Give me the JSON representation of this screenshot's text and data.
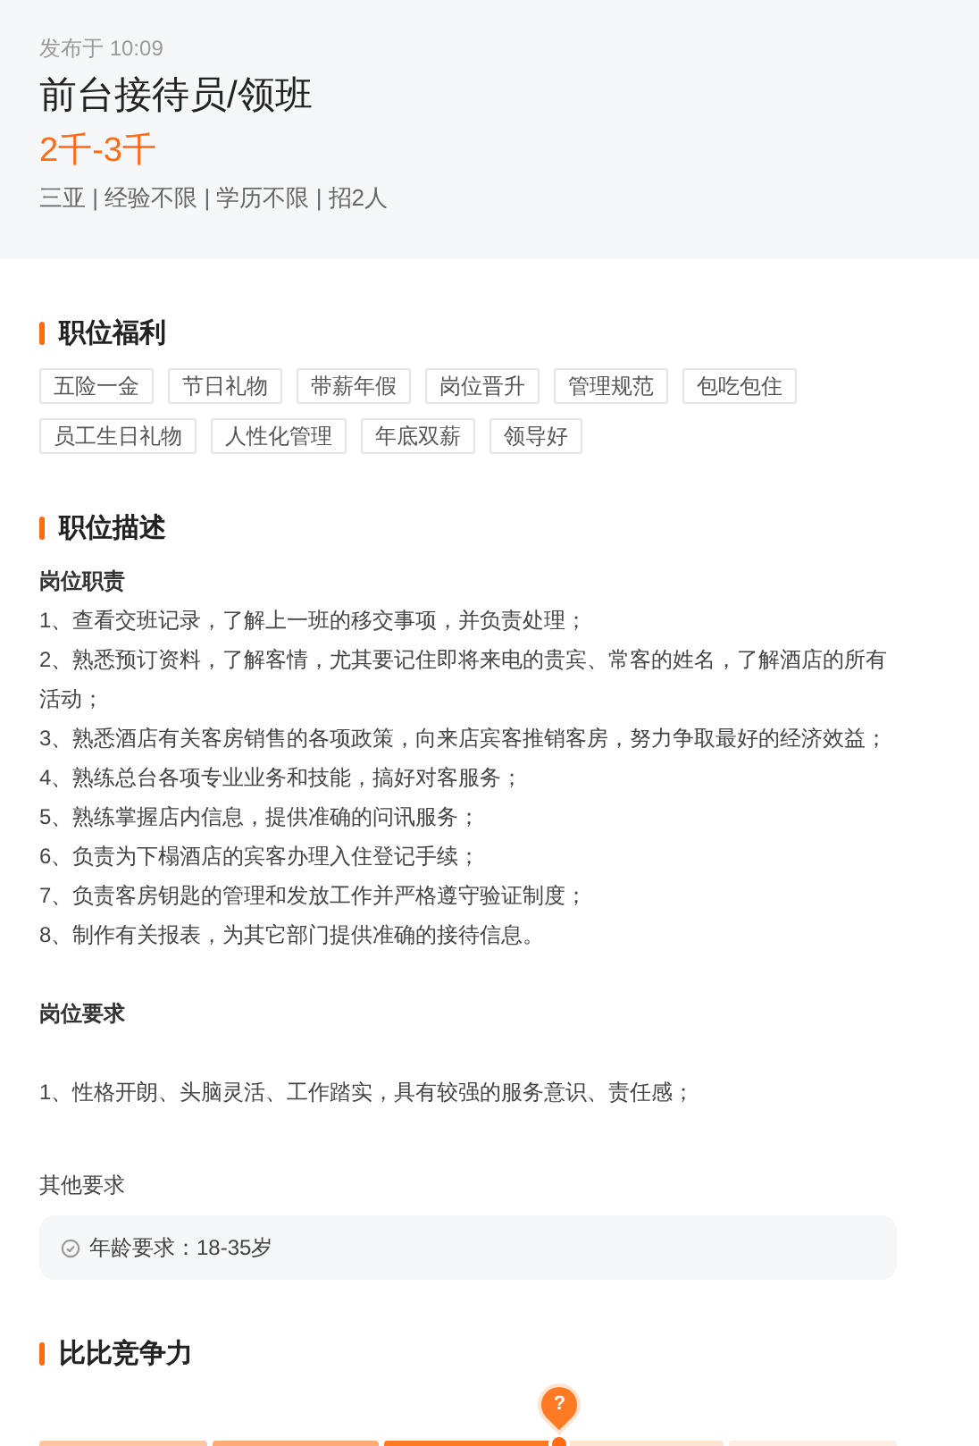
{
  "header": {
    "posted": "发布于 10:09",
    "title": "前台接待员/领班",
    "salary": "2千-3千",
    "meta": "三亚 | 经验不限 | 学历不限 | 招2人"
  },
  "benefits": {
    "title": "职位福利",
    "tags": [
      "五险一金",
      "节日礼物",
      "带薪年假",
      "岗位晋升",
      "管理规范",
      "包吃包住",
      "员工生日礼物",
      "人性化管理",
      "年底双薪",
      "领导好"
    ]
  },
  "description": {
    "title": "职位描述",
    "duties_title": "岗位职责",
    "duties": [
      "1、查看交班记录，了解上一班的移交事项，并负责处理；",
      "2、熟悉预订资料，了解客情，尤其要记住即将来电的贵宾、常客的姓名，了解酒店的所有活动；",
      "3、熟悉酒店有关客房销售的各项政策，向来店宾客推销客房，努力争取最好的经济效益；",
      "4、熟练总台各项专业业务和技能，搞好对客服务；",
      "5、熟练掌握店内信息，提供准确的问讯服务；",
      "6、负责为下榻酒店的宾客办理入住登记手续；",
      "7、负责客房钥匙的管理和发放工作并严格遵守验证制度；",
      "8、制作有关报表，为其它部门提供准确的接待信息。"
    ],
    "requirements_title": "岗位要求",
    "requirements": [
      "1、性格开朗、头脑灵活、工作踏实，具有较强的服务意识、责任感；"
    ],
    "other_title": "其他要求",
    "other_items": [
      "年龄要求：18-35岁"
    ]
  },
  "competitiveness": {
    "title": "比比竞争力",
    "marker": "?"
  }
}
